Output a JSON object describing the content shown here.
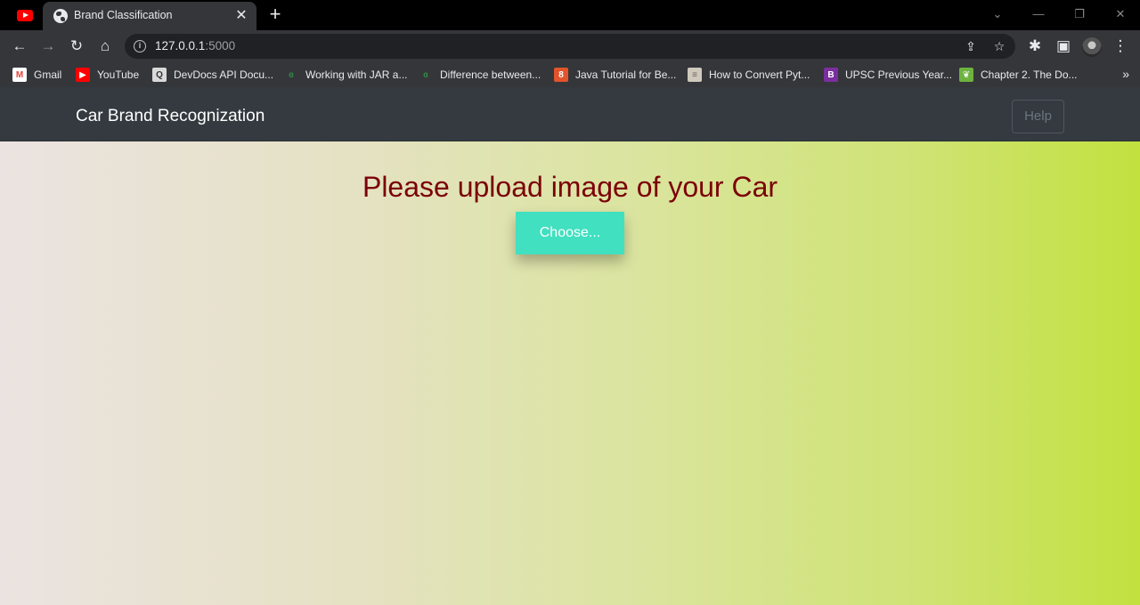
{
  "browser": {
    "tab": {
      "title": "Brand Classification",
      "close": "✕"
    },
    "new_tab": "+",
    "window": {
      "tab_search": "⌄",
      "minimize": "—",
      "restore": "❐",
      "close": "✕"
    },
    "nav": {
      "back": "←",
      "forward": "→",
      "reload": "↻",
      "home": "⌂"
    },
    "url": {
      "host": "127.0.0.1",
      "port": ":5000"
    },
    "info_icon": "i",
    "omnibox_icons": {
      "share": "⇪",
      "bookmark_star": "☆"
    },
    "toolbar_icons": {
      "extensions": "✱",
      "side_panel": "▣",
      "menu": "⋮"
    },
    "bookmarks": [
      {
        "label": "Gmail",
        "icon": "gmail-icon",
        "glyph": "M",
        "color": "#ffffff",
        "fg": "#ea4335"
      },
      {
        "label": "YouTube",
        "icon": "youtube-icon",
        "glyph": "▶",
        "color": "#ff0000",
        "fg": "#ffffff"
      },
      {
        "label": "DevDocs API Docu...",
        "icon": "devdocs-icon",
        "glyph": "Q",
        "color": "#d9d9d9",
        "fg": "#333333"
      },
      {
        "label": "Working with JAR a...",
        "icon": "geeksforgeeks-icon",
        "glyph": "ɞ",
        "color": "transparent",
        "fg": "#2f8d46"
      },
      {
        "label": "Difference between...",
        "icon": "geeksforgeeks-icon",
        "glyph": "ɞ",
        "color": "transparent",
        "fg": "#2f8d46"
      },
      {
        "label": "Java Tutorial for Be...",
        "icon": "tutorial-icon",
        "glyph": "8",
        "color": "#e2542c",
        "fg": "#ffffff"
      },
      {
        "label": "How to Convert Pyt...",
        "icon": "page-thumbnail-icon",
        "glyph": "≡",
        "color": "#cfc9bd",
        "fg": "#6b6357"
      },
      {
        "label": "UPSC Previous Year...",
        "icon": "upsc-icon",
        "glyph": "B",
        "color": "#7b2f9e",
        "fg": "#ffffff"
      },
      {
        "label": "Chapter 2. The Do...",
        "icon": "leaf-icon",
        "glyph": "❦",
        "color": "#6db33f",
        "fg": "#ffffff"
      }
    ],
    "bookmarks_more": "»"
  },
  "page": {
    "navbar": {
      "brand": "Car Brand Recognization",
      "help_button": "Help"
    },
    "heading": "Please upload image of your Car",
    "choose_button": "Choose..."
  },
  "colors": {
    "navbar_bg": "#343a40",
    "heading": "#7b0008",
    "choose_button_bg": "#40e0c0",
    "gradient": [
      "#ebe3e1",
      "#e5e2c4",
      "#dbe4a0",
      "#cfe375",
      "#c2e13e"
    ]
  }
}
